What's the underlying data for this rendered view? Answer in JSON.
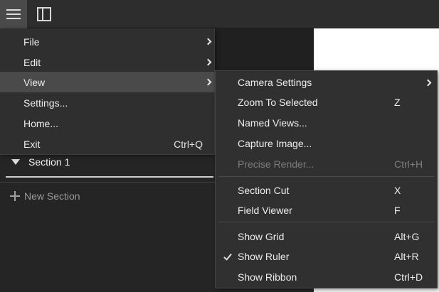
{
  "main_menu": {
    "items": [
      {
        "label": "File",
        "has_submenu": true
      },
      {
        "label": "Edit",
        "has_submenu": true
      },
      {
        "label": "View",
        "has_submenu": true,
        "active": true
      },
      {
        "label": "Settings..."
      },
      {
        "label": "Home..."
      },
      {
        "label": "Exit",
        "shortcut": "Ctrl+Q"
      }
    ]
  },
  "view_submenu": {
    "items": [
      {
        "label": "Camera Settings",
        "has_submenu": true
      },
      {
        "label": "Zoom To Selected",
        "shortcut": "Z"
      },
      {
        "label": "Named Views..."
      },
      {
        "label": "Capture Image..."
      },
      {
        "label": "Precise Render...",
        "shortcut": "Ctrl+H",
        "disabled": true
      },
      {
        "label": "Section Cut",
        "shortcut": "X"
      },
      {
        "label": "Field Viewer",
        "shortcut": "F"
      },
      {
        "label": "Show Grid",
        "shortcut": "Alt+G"
      },
      {
        "label": "Show Ruler",
        "shortcut": "Alt+R",
        "checked": true
      },
      {
        "label": "Show Ribbon",
        "shortcut": "Ctrl+D"
      }
    ]
  },
  "sections": {
    "section_1_label": "Section 1",
    "new_section_label": "New Section"
  },
  "icons": {
    "menu": "hamburger-menu-icon",
    "panel": "panel-layout-icon",
    "section_toggle": "triangle-down-icon",
    "add": "plus-icon",
    "submenu": "chevron-right-icon",
    "check": "checkmark-icon"
  },
  "colors": {
    "menu_bg": "#2f2f2f",
    "menu_active": "#4a4a4a",
    "disabled_text": "#7c7c7c",
    "text": "#ececec"
  }
}
